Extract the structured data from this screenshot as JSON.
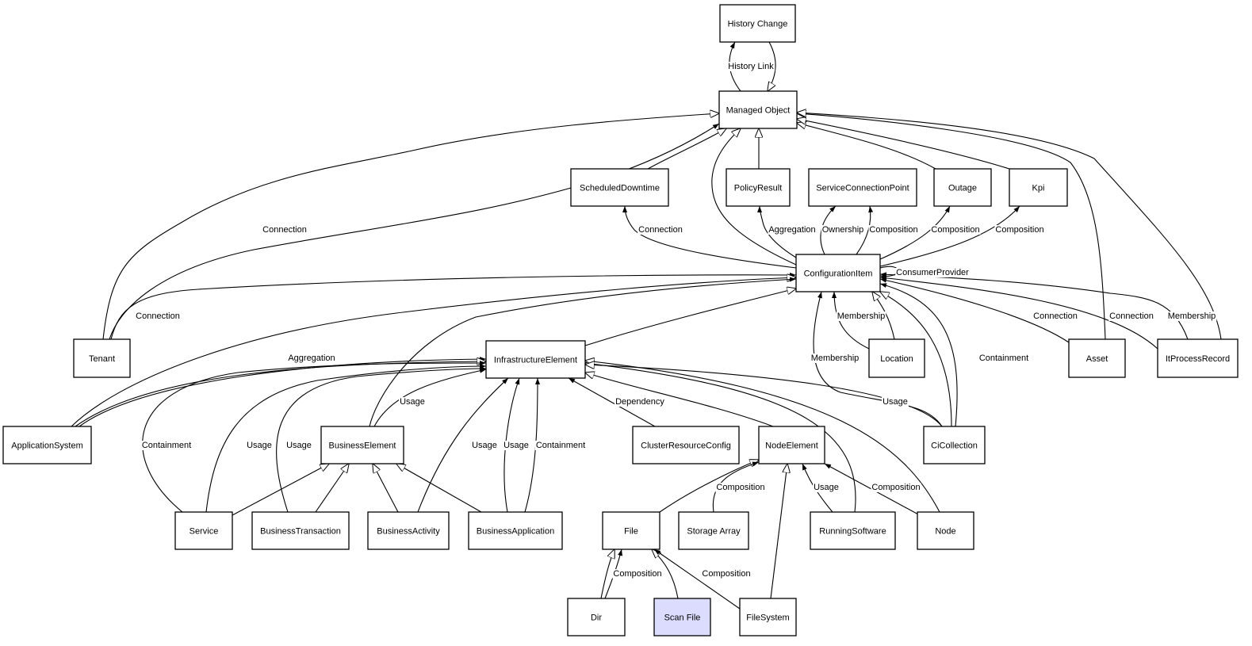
{
  "colors": {
    "node_fill": "#ffffff",
    "highlight_fill": "#dcdcff",
    "stroke": "#000000"
  },
  "nodes": [
    {
      "id": "HistoryChange",
      "label": "History Change"
    },
    {
      "id": "ManagedObject",
      "label": "Managed Object"
    },
    {
      "id": "ScheduledDowntime",
      "label": "ScheduledDowntime"
    },
    {
      "id": "PolicyResult",
      "label": "PolicyResult"
    },
    {
      "id": "ServiceConnectionPoint",
      "label": "ServiceConnectionPoint"
    },
    {
      "id": "Outage",
      "label": "Outage"
    },
    {
      "id": "Kpi",
      "label": "Kpi"
    },
    {
      "id": "ConfigurationItem",
      "label": "ConfigurationItem"
    },
    {
      "id": "Tenant",
      "label": "Tenant"
    },
    {
      "id": "InfrastructureElement",
      "label": "InfrastructureElement"
    },
    {
      "id": "Location",
      "label": "Location"
    },
    {
      "id": "Asset",
      "label": "Asset"
    },
    {
      "id": "ItProcessRecord",
      "label": "ItProcessRecord"
    },
    {
      "id": "ApplicationSystem",
      "label": "ApplicationSystem"
    },
    {
      "id": "BusinessElement",
      "label": "BusinessElement"
    },
    {
      "id": "ClusterResourceConfig",
      "label": "ClusterResourceConfig"
    },
    {
      "id": "NodeElement",
      "label": "NodeElement"
    },
    {
      "id": "CiCollection",
      "label": "CiCollection"
    },
    {
      "id": "Service",
      "label": "Service"
    },
    {
      "id": "BusinessTransaction",
      "label": "BusinessTransaction"
    },
    {
      "id": "BusinessActivity",
      "label": "BusinessActivity"
    },
    {
      "id": "BusinessApplication",
      "label": "BusinessApplication"
    },
    {
      "id": "File",
      "label": "File"
    },
    {
      "id": "StorageArray",
      "label": "Storage Array"
    },
    {
      "id": "RunningSoftware",
      "label": "RunningSoftware"
    },
    {
      "id": "Node",
      "label": "Node"
    },
    {
      "id": "Dir",
      "label": "Dir"
    },
    {
      "id": "ScanFile",
      "label": "Scan File",
      "highlighted": true
    },
    {
      "id": "FileSystem",
      "label": "FileSystem"
    }
  ],
  "edges": [
    {
      "from": "ManagedObject",
      "to": "HistoryChange",
      "kind": "association",
      "label": "History Link"
    },
    {
      "from": "HistoryChange",
      "to": "ManagedObject",
      "kind": "generalization",
      "label": ""
    },
    {
      "from": "Tenant",
      "to": "ManagedObject",
      "kind": "generalization",
      "label": ""
    },
    {
      "from": "Tenant",
      "to": "ManagedObject",
      "kind": "association",
      "label": "Connection"
    },
    {
      "from": "ScheduledDowntime",
      "to": "ManagedObject",
      "kind": "generalization",
      "label": ""
    },
    {
      "from": "ConfigurationItem",
      "to": "ManagedObject",
      "kind": "generalization",
      "label": ""
    },
    {
      "from": "PolicyResult",
      "to": "ManagedObject",
      "kind": "generalization",
      "label": ""
    },
    {
      "from": "Outage",
      "to": "ManagedObject",
      "kind": "generalization",
      "label": ""
    },
    {
      "from": "Kpi",
      "to": "ManagedObject",
      "kind": "generalization",
      "label": ""
    },
    {
      "from": "Asset",
      "to": "ManagedObject",
      "kind": "generalization",
      "label": ""
    },
    {
      "from": "ItProcessRecord",
      "to": "ManagedObject",
      "kind": "generalization",
      "label": ""
    },
    {
      "from": "ConfigurationItem",
      "to": "ScheduledDowntime",
      "kind": "association",
      "label": "Connection"
    },
    {
      "from": "ConfigurationItem",
      "to": "PolicyResult",
      "kind": "association",
      "label": "Aggregation"
    },
    {
      "from": "ConfigurationItem",
      "to": "ServiceConnectionPoint",
      "kind": "association",
      "label": "Ownership"
    },
    {
      "from": "ConfigurationItem",
      "to": "ServiceConnectionPoint",
      "kind": "association",
      "label": "Composition"
    },
    {
      "from": "ConfigurationItem",
      "to": "Outage",
      "kind": "association",
      "label": "Composition"
    },
    {
      "from": "ConfigurationItem",
      "to": "Kpi",
      "kind": "association",
      "label": "Composition"
    },
    {
      "from": "ConfigurationItem",
      "to": "ConfigurationItem",
      "kind": "association",
      "label": "ConsumerProvider"
    },
    {
      "from": "Tenant",
      "to": "ConfigurationItem",
      "kind": "association",
      "label": "Connection"
    },
    {
      "from": "ApplicationSystem",
      "to": "ConfigurationItem",
      "kind": "generalization",
      "label": ""
    },
    {
      "from": "InfrastructureElement",
      "to": "ConfigurationItem",
      "kind": "generalization",
      "label": ""
    },
    {
      "from": "BusinessElement",
      "to": "ConfigurationItem",
      "kind": "association",
      "label": ""
    },
    {
      "from": "Location",
      "to": "ConfigurationItem",
      "kind": "generalization",
      "label": ""
    },
    {
      "from": "Location",
      "to": "ConfigurationItem",
      "kind": "association",
      "label": "Membership"
    },
    {
      "from": "CiCollection",
      "to": "ConfigurationItem",
      "kind": "association",
      "label": "Membership"
    },
    {
      "from": "CiCollection",
      "to": "ConfigurationItem",
      "kind": "generalization",
      "label": ""
    },
    {
      "from": "CiCollection",
      "to": "ConfigurationItem",
      "kind": "association",
      "label": "Containment"
    },
    {
      "from": "Asset",
      "to": "ConfigurationItem",
      "kind": "association",
      "label": "Connection"
    },
    {
      "from": "ItProcessRecord",
      "to": "ConfigurationItem",
      "kind": "association",
      "label": "Connection"
    },
    {
      "from": "ItProcessRecord",
      "to": "ConfigurationItem",
      "kind": "association",
      "label": "Membership"
    },
    {
      "from": "ApplicationSystem",
      "to": "InfrastructureElement",
      "kind": "association",
      "label": "Aggregation"
    },
    {
      "from": "ApplicationSystem",
      "to": "InfrastructureElement",
      "kind": "generalization",
      "label": ""
    },
    {
      "from": "Service",
      "to": "InfrastructureElement",
      "kind": "association",
      "label": "Containment"
    },
    {
      "from": "Service",
      "to": "InfrastructureElement",
      "kind": "association",
      "label": "Usage"
    },
    {
      "from": "BusinessTransaction",
      "to": "InfrastructureElement",
      "kind": "association",
      "label": "Usage"
    },
    {
      "from": "BusinessElement",
      "to": "InfrastructureElement",
      "kind": "association",
      "label": "Usage"
    },
    {
      "from": "BusinessActivity",
      "to": "InfrastructureElement",
      "kind": "association",
      "label": "Usage"
    },
    {
      "from": "BusinessApplication",
      "to": "InfrastructureElement",
      "kind": "association",
      "label": "Usage"
    },
    {
      "from": "BusinessApplication",
      "to": "InfrastructureElement",
      "kind": "association",
      "label": "Containment"
    },
    {
      "from": "ClusterResourceConfig",
      "to": "InfrastructureElement",
      "kind": "association",
      "label": "Dependency"
    },
    {
      "from": "NodeElement",
      "to": "InfrastructureElement",
      "kind": "generalization",
      "label": ""
    },
    {
      "from": "RunningSoftware",
      "to": "InfrastructureElement",
      "kind": "generalization",
      "label": ""
    },
    {
      "from": "Node",
      "to": "InfrastructureElement",
      "kind": "generalization",
      "label": ""
    },
    {
      "from": "CiCollection",
      "to": "InfrastructureElement",
      "kind": "generalization",
      "label": "Usage"
    },
    {
      "from": "Service",
      "to": "BusinessElement",
      "kind": "generalization",
      "label": ""
    },
    {
      "from": "BusinessTransaction",
      "to": "BusinessElement",
      "kind": "generalization",
      "label": ""
    },
    {
      "from": "BusinessActivity",
      "to": "BusinessElement",
      "kind": "generalization",
      "label": ""
    },
    {
      "from": "BusinessApplication",
      "to": "BusinessElement",
      "kind": "generalization",
      "label": ""
    },
    {
      "from": "File",
      "to": "NodeElement",
      "kind": "generalization",
      "label": ""
    },
    {
      "from": "StorageArray",
      "to": "NodeElement",
      "kind": "association",
      "label": "Composition"
    },
    {
      "from": "FileSystem",
      "to": "NodeElement",
      "kind": "generalization",
      "label": ""
    },
    {
      "from": "RunningSoftware",
      "to": "NodeElement",
      "kind": "association",
      "label": "Usage"
    },
    {
      "from": "Node",
      "to": "NodeElement",
      "kind": "association",
      "label": "Composition"
    },
    {
      "from": "Dir",
      "to": "File",
      "kind": "generalization",
      "label": ""
    },
    {
      "from": "Dir",
      "to": "File",
      "kind": "association",
      "label": "Composition"
    },
    {
      "from": "ScanFile",
      "to": "File",
      "kind": "generalization",
      "label": ""
    },
    {
      "from": "FileSystem",
      "to": "File",
      "kind": "association",
      "label": "Composition"
    }
  ]
}
